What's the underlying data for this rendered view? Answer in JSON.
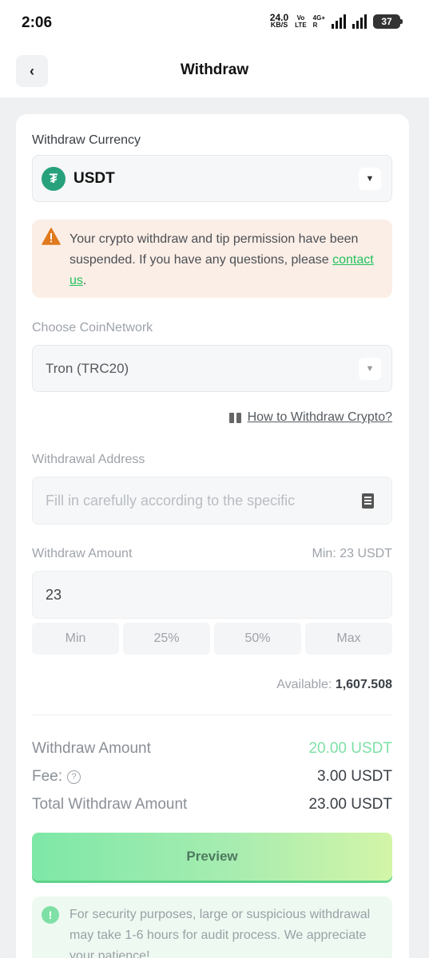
{
  "status_bar": {
    "time": "2:06",
    "speed_value": "24.0",
    "speed_unit": "KB/S",
    "volte_top": "Vo",
    "volte_bottom": "LTE",
    "network": "4G+",
    "network_r": "R",
    "battery": "37"
  },
  "header": {
    "title": "Withdraw"
  },
  "currency": {
    "label": "Withdraw Currency",
    "value": "USDT"
  },
  "warning": {
    "text": "Your crypto withdraw and tip permission have been suspended. If you have any questions, please ",
    "link": "contact us",
    "suffix": "."
  },
  "network": {
    "label": "Choose CoinNetwork",
    "value": "Tron (TRC20)"
  },
  "howto": {
    "label": "How to Withdraw Crypto?"
  },
  "address": {
    "label": "Withdrawal Address",
    "placeholder": "Fill in carefully according to the specific"
  },
  "amount": {
    "label": "Withdraw Amount",
    "min_label": "Min: 23 USDT",
    "value": "23"
  },
  "quick_buttons": [
    "Min",
    "25%",
    "50%",
    "Max"
  ],
  "available": {
    "label": "Available:",
    "value": "1,607.508"
  },
  "summary": {
    "withdraw_label": "Withdraw Amount",
    "withdraw_value": "20.00 USDT",
    "fee_label": "Fee:",
    "fee_value": "3.00 USDT",
    "total_label": "Total Withdraw Amount",
    "total_value": "23.00 USDT"
  },
  "preview_button": "Preview",
  "info": {
    "text": "For security purposes, large or suspicious withdrawal may take 1-6 hours for audit process. We appreciate your patience!"
  },
  "colors": {
    "accent_green": "#22c25e",
    "warning_bg": "#fbeee6",
    "warning_icon": "#e07a1f",
    "usdt": "#26a17b"
  }
}
